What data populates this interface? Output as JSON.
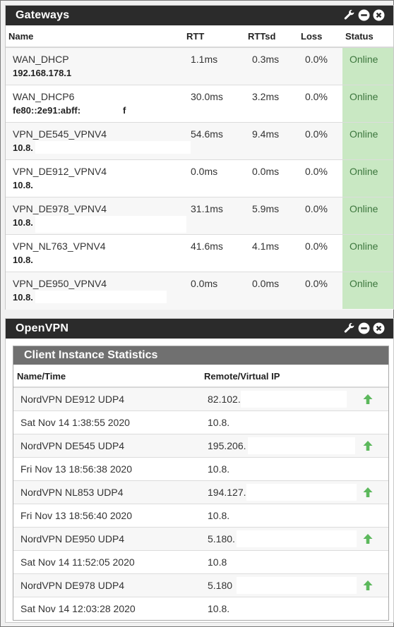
{
  "gateways": {
    "title": "Gateways",
    "columns": {
      "name": "Name",
      "rtt": "RTT",
      "rttsd": "RTTsd",
      "loss": "Loss",
      "status": "Status"
    },
    "rows": [
      {
        "name": "WAN_DHCP",
        "address": "192.168.178.1",
        "rtt": "1.1ms",
        "rttsd": "0.3ms",
        "loss": "0.0%",
        "status": "Online"
      },
      {
        "name": "WAN_DHCP6",
        "address": "fe80::2e91:abff:",
        "address_tail": "f",
        "rtt": "30.0ms",
        "rttsd": "3.2ms",
        "loss": "0.0%",
        "status": "Online"
      },
      {
        "name": "VPN_DE545_VPNV4",
        "address": "10.8.",
        "rtt": "54.6ms",
        "rttsd": "9.4ms",
        "loss": "0.0%",
        "status": "Online"
      },
      {
        "name": "VPN_DE912_VPNV4",
        "address": "10.8.",
        "rtt": "0.0ms",
        "rttsd": "0.0ms",
        "loss": "0.0%",
        "status": "Online"
      },
      {
        "name": "VPN_DE978_VPNV4",
        "address": "10.8.",
        "rtt": "31.1ms",
        "rttsd": "5.9ms",
        "loss": "0.0%",
        "status": "Online"
      },
      {
        "name": "VPN_NL763_VPNV4",
        "address": "10.8.",
        "rtt": "41.6ms",
        "rttsd": "4.1ms",
        "loss": "0.0%",
        "status": "Online"
      },
      {
        "name": "VPN_DE950_VPNV4",
        "address": "10.8.",
        "rtt": "0.0ms",
        "rttsd": "0.0ms",
        "loss": "0.0%",
        "status": "Online"
      }
    ]
  },
  "openvpn": {
    "title": "OpenVPN",
    "section_title": "Client Instance Statistics",
    "columns": {
      "name_time": "Name/Time",
      "remote_ip": "Remote/Virtual IP"
    },
    "clients": [
      {
        "name": "NordVPN DE912 UDP4",
        "remote": "82.102.",
        "time": "Sat Nov 14 1:38:55 2020",
        "virtual": "10.8."
      },
      {
        "name": "NordVPN DE545 UDP4",
        "remote": "195.206.",
        "time": "Fri Nov 13 18:56:38 2020",
        "virtual": "10.8."
      },
      {
        "name": "NordVPN NL853 UDP4",
        "remote": "194.127.",
        "time": "Fri Nov 13 18:56:40 2020",
        "virtual": "10.8."
      },
      {
        "name": "NordVPN DE950 UDP4",
        "remote": "5.180.",
        "time": "Sat Nov 14 11:52:05 2020",
        "virtual": "10.8"
      },
      {
        "name": "NordVPN DE978 UDP4",
        "remote": "5.180",
        "time": "Sat Nov 14 12:03:28 2020",
        "virtual": "10.8."
      }
    ]
  },
  "icons": {
    "settings": "wrench-icon",
    "minimize": "minus-circle-icon",
    "close": "close-circle-icon",
    "status_up": "arrow-up-icon"
  },
  "colors": {
    "header_bg": "#2b2b2b",
    "online_bg": "#c9e8c3",
    "online_text": "#3c763d",
    "arrow_green": "#5cb85c",
    "section_bg": "#707070"
  }
}
